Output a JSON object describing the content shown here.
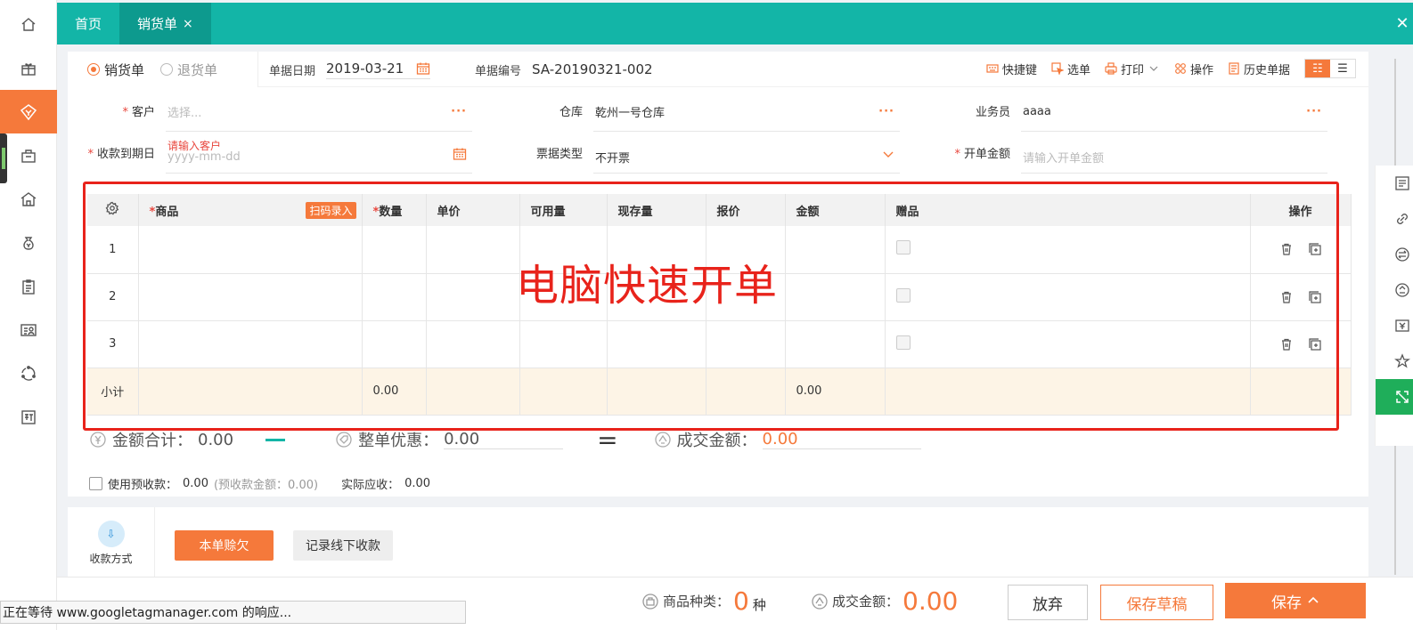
{
  "nav": {
    "items": [
      {
        "icon": "home-icon",
        "active": false
      },
      {
        "icon": "gift-icon",
        "active": false
      },
      {
        "icon": "sales-icon",
        "active": true
      },
      {
        "icon": "purchase-bag-icon",
        "active": false
      },
      {
        "icon": "warehouse-icon",
        "active": false
      },
      {
        "icon": "money-bag-icon",
        "active": false
      },
      {
        "icon": "clipboard-icon",
        "active": false
      },
      {
        "icon": "contact-card-icon",
        "active": false
      },
      {
        "icon": "cycle-icon",
        "active": false
      },
      {
        "icon": "new-badge-icon",
        "active": false
      }
    ]
  },
  "tabs": {
    "home": "首页",
    "current": "销货单",
    "close_glyph": "×"
  },
  "form": {
    "type_sales": "销货单",
    "type_return": "退货单",
    "date_label": "单据日期",
    "date_value": "2019-03-21",
    "no_label": "单据编号",
    "no_value": "SA-20190321-002",
    "customer_label": "客户",
    "customer_placeholder": "选择...",
    "customer_error": "请输入客户",
    "warehouse_label": "仓库",
    "warehouse_value": "乾州一号仓库",
    "salesman_label": "业务员",
    "salesman_value": "aaaa",
    "due_label": "收款到期日",
    "due_placeholder": "yyyy-mm-dd",
    "invoice_type_label": "票据类型",
    "invoice_type_value": "不开票",
    "invoice_amount_label": "开单金额",
    "invoice_amount_placeholder": "请输入开单金额",
    "dots": "···"
  },
  "toolbar": {
    "shortcut": "快捷键",
    "select": "选单",
    "print": "打印",
    "operate": "操作",
    "history": "历史单据"
  },
  "table": {
    "headers": {
      "product": "商品",
      "scan": "扫码录入",
      "qty": "数量",
      "price": "单价",
      "available": "可用量",
      "stock": "现存量",
      "quote": "报价",
      "amount": "金额",
      "gift": "赠品",
      "ops": "操作"
    },
    "rows": [
      "1",
      "2",
      "3"
    ],
    "subtotal_label": "小计",
    "subtotal_qty": "0.00",
    "subtotal_amount": "0.00"
  },
  "overlay_text": "电脑快速开单",
  "totals": {
    "sum_label": "金额合计：",
    "sum_value": "0.00",
    "discount_label": "整单优惠：",
    "discount_value": "0.00",
    "deal_label": "成交金额：",
    "deal_value": "0.00",
    "eq": "="
  },
  "prepay": {
    "label": "使用预收款：",
    "value": "0.00",
    "note": "(预收款金额：0.00)",
    "actual_label": "实际应收：",
    "actual_value": "0.00"
  },
  "payment": {
    "method_label": "收款方式",
    "owe_button": "本单赊欠",
    "offline_button": "记录线下收款"
  },
  "bottom": {
    "kinds_label": "商品种类：",
    "kinds_value": "0",
    "kinds_unit": "种",
    "deal_label": "成交金额：",
    "deal_value": "0.00",
    "discard": "放弃",
    "draft": "保存草稿",
    "save": "保存"
  },
  "status_text": "正在等待 www.googletagmanager.com 的响应...",
  "colors": {
    "accent": "#f5793b",
    "teal": "#13b5a7",
    "alert_red": "#e8231b"
  }
}
